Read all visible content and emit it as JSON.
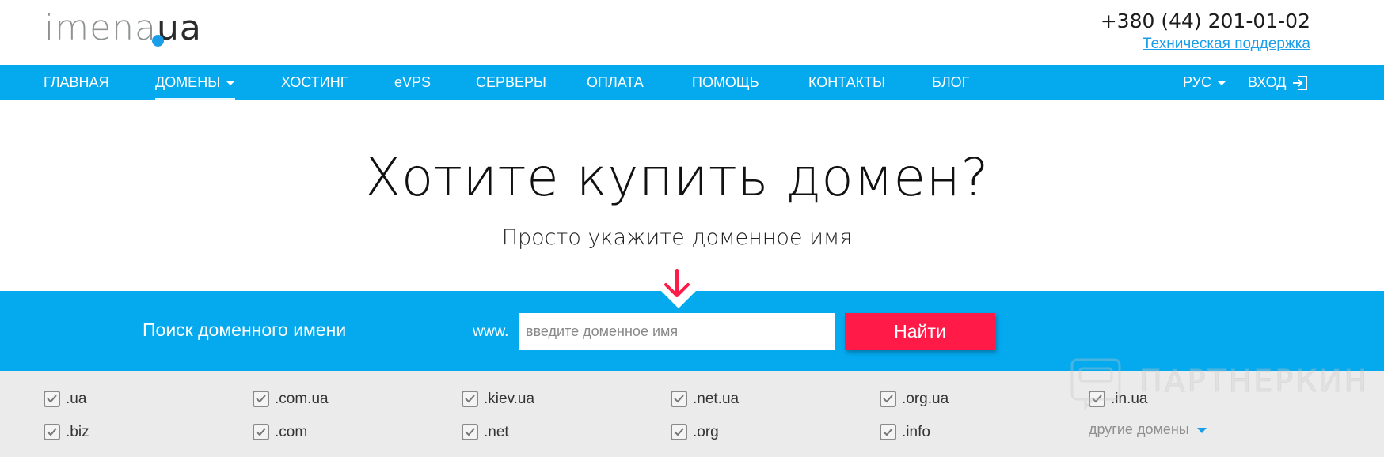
{
  "header": {
    "logo": {
      "name": "imena",
      "tld": "ua",
      "dot_color": "#1a9ee8"
    },
    "phone": "+380 (44) 201-01-02",
    "support_link": "Техническая поддержка"
  },
  "nav": {
    "items": [
      {
        "label": "ГЛАВНАЯ"
      },
      {
        "label": "ДОМЕНЫ",
        "active": true,
        "dropdown": true
      },
      {
        "label": "ХОСТИНГ"
      },
      {
        "label": "eVPS"
      },
      {
        "label": "СЕРВЕРЫ"
      },
      {
        "label": "ОПЛАТА"
      },
      {
        "label": "ПОМОЩЬ"
      },
      {
        "label": "КОНТАКТЫ"
      },
      {
        "label": "БЛОГ"
      }
    ],
    "language": "РУС",
    "login": "ВХОД",
    "background": "#05a9ee"
  },
  "hero": {
    "title": "Хотите купить домен?",
    "subtitle": "Просто укажите доменное имя"
  },
  "search": {
    "label": "Поиск доменного имени",
    "prefix": "www.",
    "placeholder": "введите доменное имя",
    "value": "",
    "button": "Найти",
    "button_color": "#ff1a47",
    "arrow_icon": "arrow-down-icon"
  },
  "zones": {
    "items": [
      {
        "label": ".ua",
        "checked": true
      },
      {
        "label": ".com.ua",
        "checked": true
      },
      {
        "label": ".kiev.ua",
        "checked": true
      },
      {
        "label": ".net.ua",
        "checked": true
      },
      {
        "label": ".org.ua",
        "checked": true
      },
      {
        "label": ".in.ua",
        "checked": true
      },
      {
        "label": ".biz",
        "checked": true
      },
      {
        "label": ".com",
        "checked": true
      },
      {
        "label": ".net",
        "checked": true
      },
      {
        "label": ".org",
        "checked": true
      },
      {
        "label": ".info",
        "checked": true
      }
    ],
    "more": "другие домены"
  },
  "watermark": {
    "text": "ПАРТНЕРКИН"
  }
}
